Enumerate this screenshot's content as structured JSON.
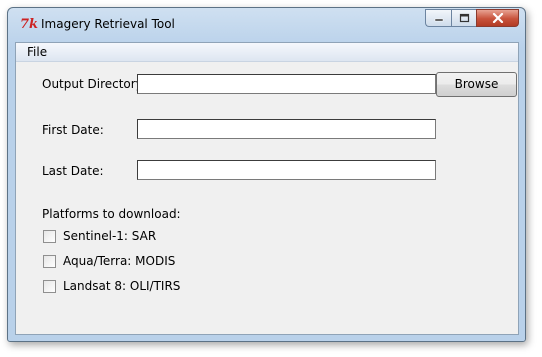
{
  "window": {
    "title": "Imagery Retrieval Tool",
    "icon": "tk-feather-icon"
  },
  "menu": {
    "file": "File"
  },
  "form": {
    "output_directory_label": "Output Directory:",
    "output_directory_value": "",
    "browse_label": "Browse",
    "first_date_label": "First Date:",
    "first_date_value": "",
    "last_date_label": "Last Date:",
    "last_date_value": "",
    "platforms_heading": "Platforms to download:",
    "platforms": [
      {
        "label": "Sentinel-1: SAR",
        "checked": false
      },
      {
        "label": "Aqua/Terra: MODIS",
        "checked": false
      },
      {
        "label": "Landsat 8: OLI/TIRS",
        "checked": false
      }
    ]
  },
  "colors": {
    "close_button": "#c8523b",
    "client_background": "#f0f0f0"
  }
}
